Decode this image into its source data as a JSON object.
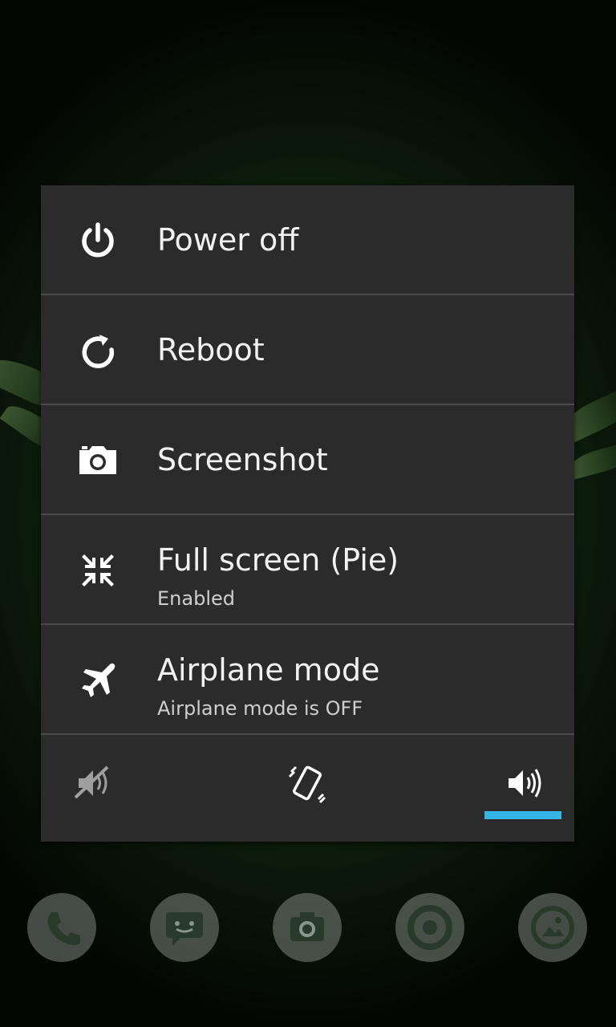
{
  "menu": {
    "items": [
      {
        "label": "Power off",
        "icon": "power-icon"
      },
      {
        "label": "Reboot",
        "icon": "reboot-icon"
      },
      {
        "label": "Screenshot",
        "icon": "camera-icon"
      },
      {
        "label": "Full screen (Pie)",
        "sublabel": "Enabled",
        "icon": "fullscreen-exit-icon"
      },
      {
        "label": "Airplane mode",
        "sublabel": "Airplane mode is OFF",
        "icon": "airplane-icon"
      }
    ]
  },
  "sound_modes": {
    "options": [
      "silent",
      "vibrate",
      "sound"
    ],
    "selected": "sound",
    "accent_color": "#33b5e5"
  },
  "dock": {
    "apps": [
      "phone-icon",
      "messaging-icon",
      "camera-icon",
      "browser-icon",
      "gallery-icon"
    ]
  },
  "colors": {
    "dialog_background": "#2b2b2b",
    "divider": "#4a4a4a",
    "text_primary": "#f2f2f2",
    "text_secondary": "#cfcfcf"
  }
}
